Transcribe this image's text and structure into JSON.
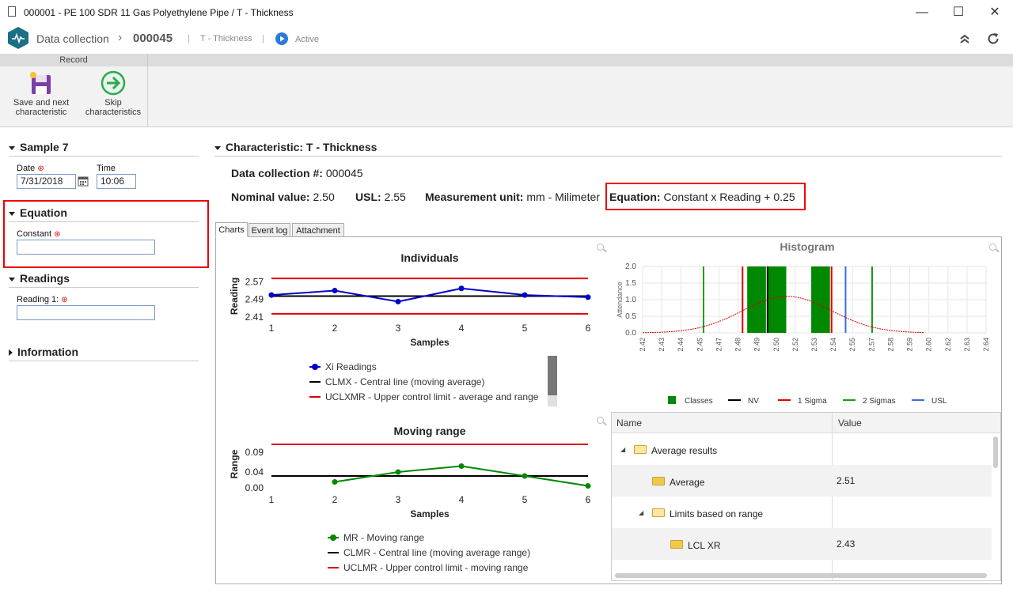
{
  "window": {
    "title": "000001 - PE 100 SDR 11 Gas Polyethylene Pipe / T - Thickness",
    "minimize": "—",
    "maximize": "☐",
    "close": "✕"
  },
  "nav": {
    "module": "Data collection",
    "separator": "›",
    "record_id": "000045",
    "pipe": "|",
    "characteristic": "T - Thickness",
    "status": "Active"
  },
  "ribbon": {
    "group_label": "Record",
    "save_next_line1": "Save and next",
    "save_next_line2": "characteristic",
    "skip_line1": "Skip",
    "skip_line2": "characteristics"
  },
  "left": {
    "sample_title": "Sample 7",
    "date_label": "Date",
    "date_value": "7/31/2018",
    "time_label": "Time",
    "time_value": "10:06",
    "equation_title": "Equation",
    "constant_label": "Constant",
    "constant_value": "",
    "readings_title": "Readings",
    "reading1_label": "Reading 1:",
    "reading1_value": "",
    "information_title": "Information"
  },
  "characteristic": {
    "header": "Characteristic: T - Thickness",
    "dc_label": "Data collection #:",
    "dc_value": "000045",
    "nominal_label": "Nominal value:",
    "nominal_value": "2.50",
    "usl_label": "USL:",
    "usl_value": "2.55",
    "unit_label": "Measurement unit:",
    "unit_value": "mm - Milimeter",
    "equation_label": "Equation:",
    "equation_value": "Constant x Reading + 0.25"
  },
  "tabs": [
    "Charts",
    "Event log",
    "Attachment"
  ],
  "chart_data": [
    {
      "type": "line",
      "title": "Individuals",
      "xlabel": "Samples",
      "ylabel": "Reading",
      "x": [
        1,
        2,
        3,
        4,
        5,
        6
      ],
      "y_ticks": [
        "2.57",
        "2.49",
        "2.41"
      ],
      "ylim": [
        2.41,
        2.6
      ],
      "series": [
        {
          "name": "Xi Readings",
          "values": [
            2.51,
            2.53,
            2.48,
            2.54,
            2.51,
            2.5
          ],
          "color": "#0000cc"
        },
        {
          "name": "CLMX - Central line (moving average)",
          "values": [
            2.505,
            2.505,
            2.505,
            2.505,
            2.505,
            2.505
          ],
          "color": "#000000"
        },
        {
          "name": "UCLXMR - Upper control limit - average and range",
          "values": [
            2.585,
            2.585,
            2.585,
            2.585,
            2.585,
            2.585
          ],
          "color": "#e00000"
        }
      ],
      "lower_limit": 2.425
    },
    {
      "type": "line",
      "title": "Moving range",
      "xlabel": "Samples",
      "ylabel": "Range",
      "x": [
        1,
        2,
        3,
        4,
        5,
        6
      ],
      "y_ticks": [
        "0.09",
        "0.04",
        "0.00"
      ],
      "ylim": [
        0,
        0.12
      ],
      "series": [
        {
          "name": "MR - Moving range",
          "values": [
            null,
            0.015,
            0.04,
            0.055,
            0.03,
            0.005
          ],
          "color": "#008800"
        },
        {
          "name": "CLMR - Central line (moving average range)",
          "values": [
            0.03,
            0.03,
            0.03,
            0.03,
            0.03,
            0.03
          ],
          "color": "#000000"
        },
        {
          "name": "UCLMR - Upper control limit - moving range",
          "values": [
            0.11,
            0.11,
            0.11,
            0.11,
            0.11,
            0.11
          ],
          "color": "#e00000"
        }
      ]
    },
    {
      "type": "bar",
      "title": "Histogram",
      "ylabel": "Attendance",
      "y_ticks": [
        "2.0",
        "1.5",
        "1.0",
        "0.5",
        "0.0"
      ],
      "ylim": [
        0,
        2.0
      ],
      "x_ticks": [
        "2.42",
        "2.43",
        "2.44",
        "2.45",
        "2.47",
        "2.48",
        "2.49",
        "2.50",
        "2.52",
        "2.53",
        "2.54",
        "2.55",
        "2.57",
        "2.58",
        "2.59",
        "2.60",
        "2.62",
        "2.63",
        "2.64"
      ],
      "xlim": [
        2.42,
        2.64
      ],
      "classes": [
        {
          "from": 2.487,
          "to": 2.499,
          "value": 2
        },
        {
          "from": 2.5,
          "to": 2.512,
          "value": 2
        },
        {
          "from": 2.528,
          "to": 2.54,
          "value": 2
        }
      ],
      "nv": 2.5,
      "one_sigma": [
        2.484,
        2.541
      ],
      "two_sigma": [
        2.459,
        2.567
      ],
      "usl": 2.55,
      "legend": [
        "Classes",
        "NV",
        "1 Sigma",
        "2 Sigmas",
        "USL"
      ]
    }
  ],
  "grid": {
    "col_name": "Name",
    "col_value": "Value",
    "rows": [
      {
        "name": "Average results",
        "value": ""
      },
      {
        "name": "Average",
        "value": "2.51"
      },
      {
        "name": "Limits based on range",
        "value": ""
      },
      {
        "name": "LCL XR",
        "value": "2.43"
      }
    ]
  }
}
